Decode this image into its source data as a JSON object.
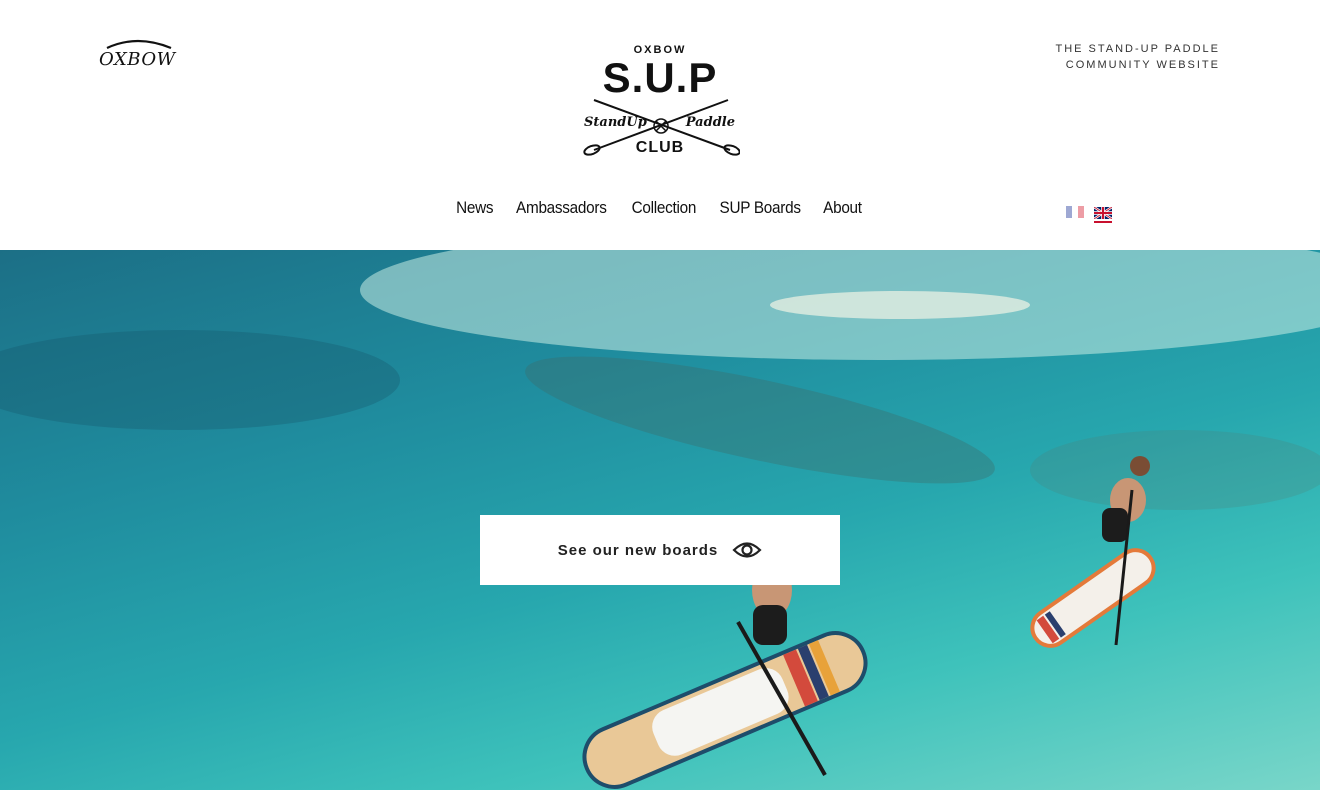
{
  "brand": {
    "name": "OXBOW"
  },
  "tagline": {
    "line1": "THE STAND-UP PADDLE",
    "line2": "COMMUNITY WEBSITE"
  },
  "club_logo": {
    "top_text": "OXBOW",
    "main_text": "S.U.P",
    "left_script": "StandUp",
    "right_script": "Paddle",
    "bottom_text": "CLUB"
  },
  "nav": {
    "items": [
      {
        "label": "News"
      },
      {
        "label": "Ambassadors"
      },
      {
        "label": "Collection"
      },
      {
        "label": "SUP Boards"
      },
      {
        "label": "About"
      }
    ]
  },
  "languages": {
    "options": [
      "French",
      "English"
    ],
    "selected": "English"
  },
  "hero": {
    "cta_label": "See our new boards",
    "cta_icon": "eye-icon"
  },
  "colors": {
    "water_deep": "#1c6f86",
    "water_shallow": "#79d6c9",
    "flag_accent": "#c8102e"
  }
}
